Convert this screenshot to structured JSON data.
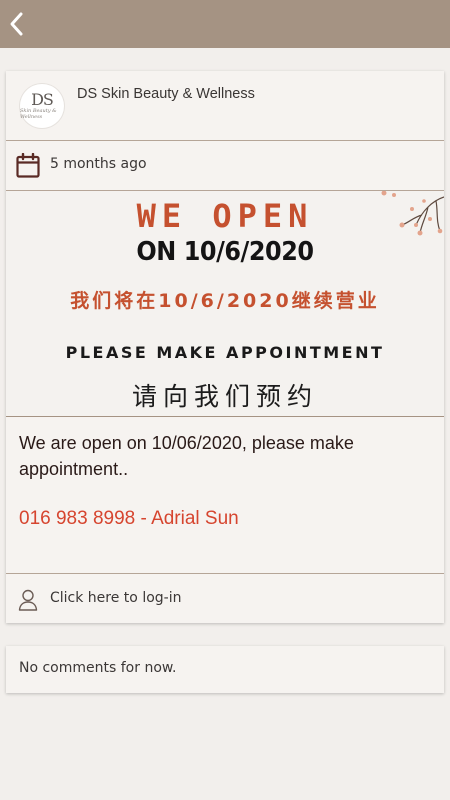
{
  "header": {
    "back_icon": "chevron-left-icon",
    "bar_color": "#a59383"
  },
  "post": {
    "business_name": "DS Skin Beauty & Wellness",
    "logo_text": "DS",
    "logo_subtext": "Skin Beauty & Wellness",
    "posted_time": "5 months ago",
    "calendar_icon": "calendar-icon",
    "banner": {
      "line1": "WE OPEN",
      "line2": "ON 10/6/2020",
      "line3": "我们将在10/6/2020继续营业",
      "line4": "PLEASE MAKE APPOINTMENT",
      "line5": "请向我们预约",
      "accent_color": "#c5512f"
    },
    "message": "We are open on 10/06/2020, please make appointment..",
    "contact": "016 983 8998 - Adrial Sun",
    "contact_color": "#d6452f",
    "login_label": "Click here to log-in",
    "login_icon": "user-icon"
  },
  "comments": {
    "empty_text": "No comments for now."
  }
}
